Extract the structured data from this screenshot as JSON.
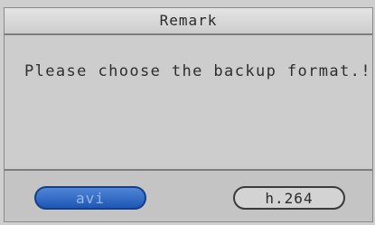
{
  "dialog": {
    "title": "Remark",
    "message": "Please choose the backup format.!"
  },
  "buttons": {
    "avi_label": "avi",
    "h264_label": "h.264"
  },
  "colors": {
    "selected_button": "#1e57b4",
    "dialog_background": "#c4c4c4"
  }
}
